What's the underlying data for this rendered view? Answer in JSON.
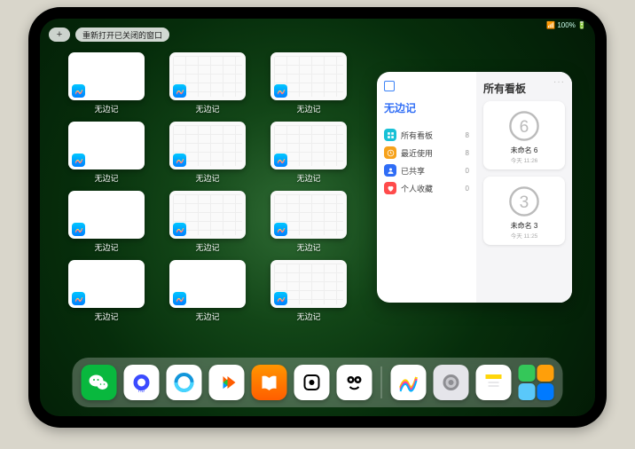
{
  "status": {
    "text": "📶 100% 🔋"
  },
  "topbar": {
    "plus": "+",
    "reopen": "重新打开已关闭的窗口"
  },
  "switcher": {
    "app_label": "无边记",
    "windows": [
      {
        "style": "blank"
      },
      {
        "style": "cal"
      },
      {
        "style": "cal"
      },
      {
        "style": "blank"
      },
      {
        "style": "cal"
      },
      {
        "style": "cal"
      },
      {
        "style": "blank"
      },
      {
        "style": "cal"
      },
      {
        "style": "cal"
      },
      {
        "style": "blank"
      },
      {
        "style": "blank"
      },
      {
        "style": "cal"
      }
    ]
  },
  "panel": {
    "more": "···",
    "left_title": "无边记",
    "right_title": "所有看板",
    "nav": [
      {
        "label": "所有看板",
        "count": "8",
        "color": "#18c1d6",
        "icon": "grid"
      },
      {
        "label": "最近使用",
        "count": "8",
        "color": "#f6a21b",
        "icon": "clock"
      },
      {
        "label": "已共享",
        "count": "0",
        "color": "#2f6df6",
        "icon": "person"
      },
      {
        "label": "个人收藏",
        "count": "0",
        "color": "#ff4b4b",
        "icon": "heart"
      }
    ],
    "boards": [
      {
        "name": "未命名 6",
        "sub": "今天 11:26",
        "digit": "6"
      },
      {
        "name": "未命名 3",
        "sub": "今天 11:25",
        "digit": "3"
      }
    ]
  },
  "dock": {
    "apps": [
      {
        "name": "wechat",
        "bg": "#09b83e"
      },
      {
        "name": "quark",
        "bg": "#ffffff"
      },
      {
        "name": "qqbrowser",
        "bg": "#ffffff"
      },
      {
        "name": "video",
        "bg": "#ffffff"
      },
      {
        "name": "books",
        "bg": "#ff9500"
      },
      {
        "name": "dice",
        "bg": "#ffffff"
      },
      {
        "name": "kuwo",
        "bg": "#ffffff"
      },
      {
        "name": "freeform",
        "bg": "#ffffff"
      },
      {
        "name": "settings",
        "bg": "#e5e5ea"
      },
      {
        "name": "notes",
        "bg": "#ffffff"
      }
    ]
  }
}
